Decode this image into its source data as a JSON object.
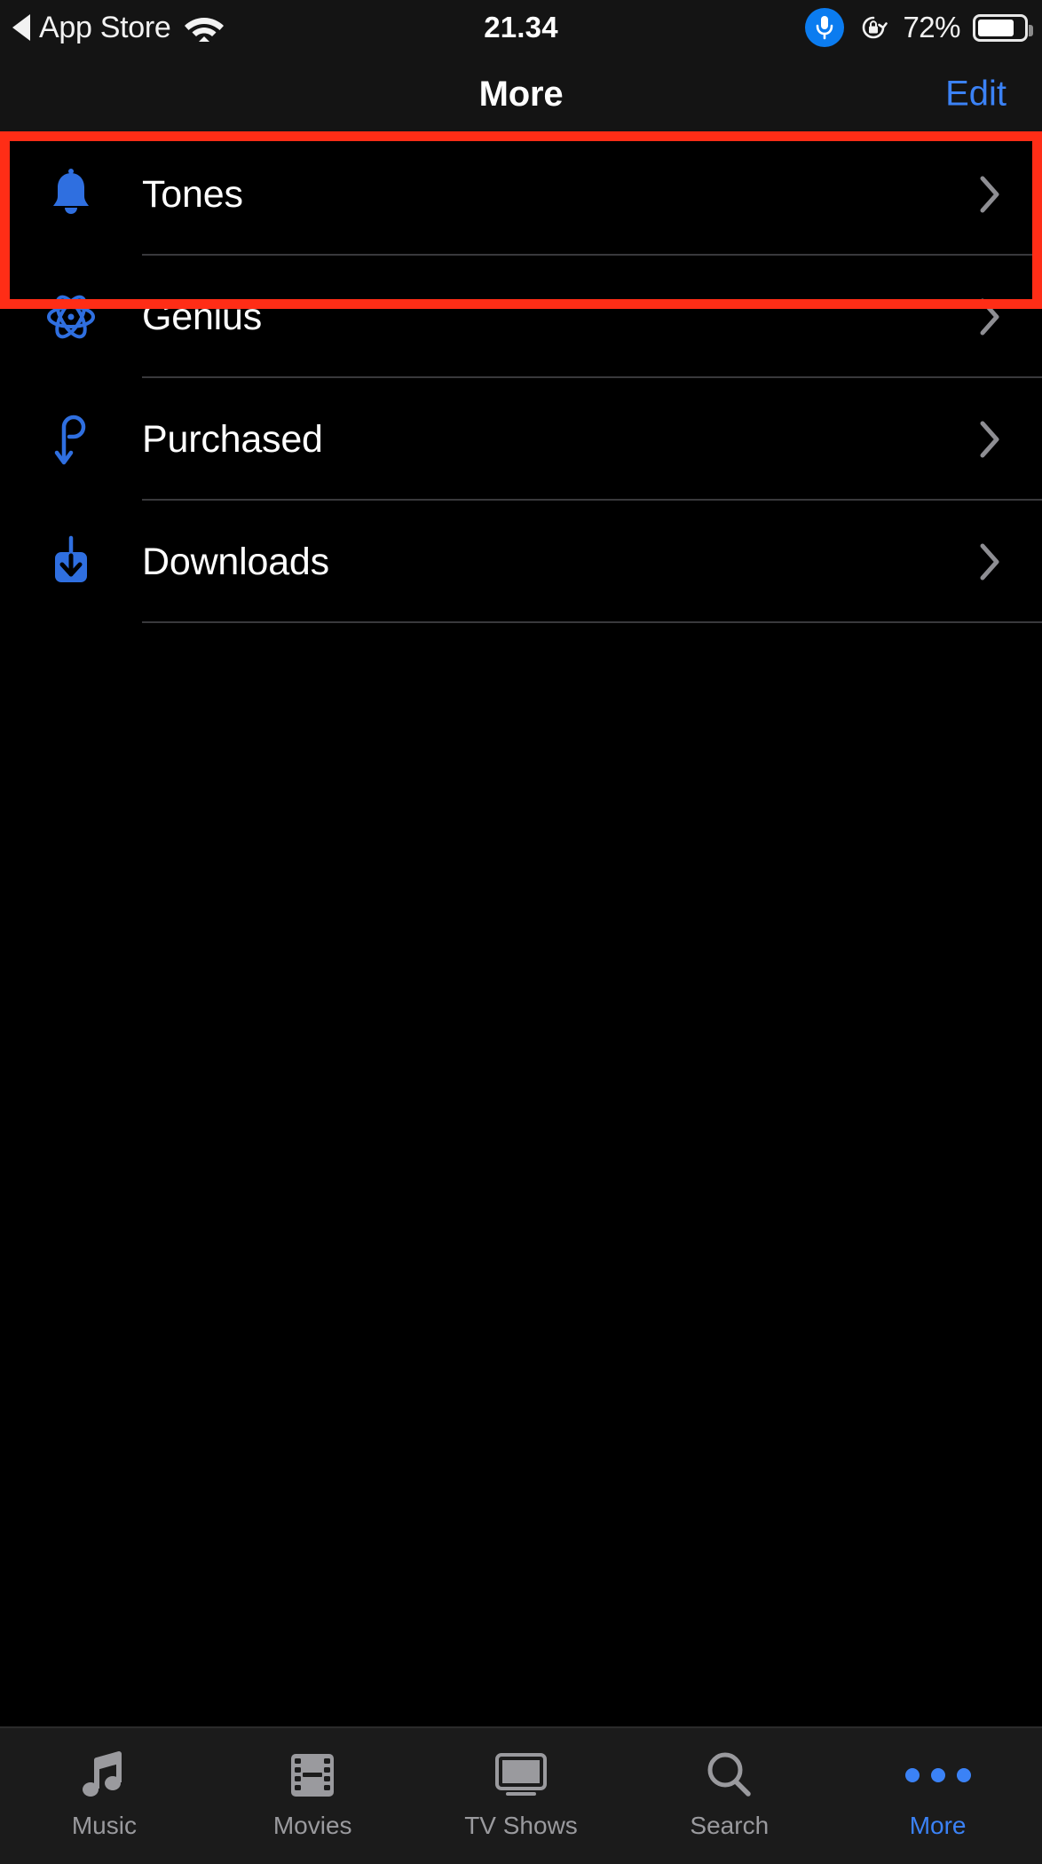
{
  "status_bar": {
    "back_label": "App Store",
    "back_icon": "back-triangle-icon",
    "wifi_icon": "wifi-icon",
    "time": "21.34",
    "mic_icon": "microphone-icon",
    "rotation_lock_icon": "rotation-lock-icon",
    "battery_percent": "72%",
    "battery_icon": "battery-icon"
  },
  "nav_bar": {
    "title": "More",
    "edit_label": "Edit"
  },
  "list": {
    "items": [
      {
        "label": "Tones",
        "icon": "bell-icon",
        "chevron": "chevron-right-icon",
        "highlighted": true
      },
      {
        "label": "Genius",
        "icon": "atom-icon",
        "chevron": "chevron-right-icon",
        "highlighted": false
      },
      {
        "label": "Purchased",
        "icon": "purchased-icon",
        "chevron": "chevron-right-icon",
        "highlighted": false
      },
      {
        "label": "Downloads",
        "icon": "download-icon",
        "chevron": "chevron-right-icon",
        "highlighted": false
      }
    ]
  },
  "tab_bar": {
    "tabs": [
      {
        "label": "Music",
        "icon": "music-note-icon",
        "active": false
      },
      {
        "label": "Movies",
        "icon": "film-strip-icon",
        "active": false
      },
      {
        "label": "TV Shows",
        "icon": "monitor-icon",
        "active": false
      },
      {
        "label": "Search",
        "icon": "magnifier-icon",
        "active": false
      },
      {
        "label": "More",
        "icon": "ellipsis-icon",
        "active": true
      }
    ]
  },
  "colors": {
    "accent_blue": "#3b82f6",
    "icon_blue": "#2f6fe0",
    "highlight_red": "#ff2d16",
    "inactive_gray": "#9a9a9e",
    "background": "#000000"
  }
}
